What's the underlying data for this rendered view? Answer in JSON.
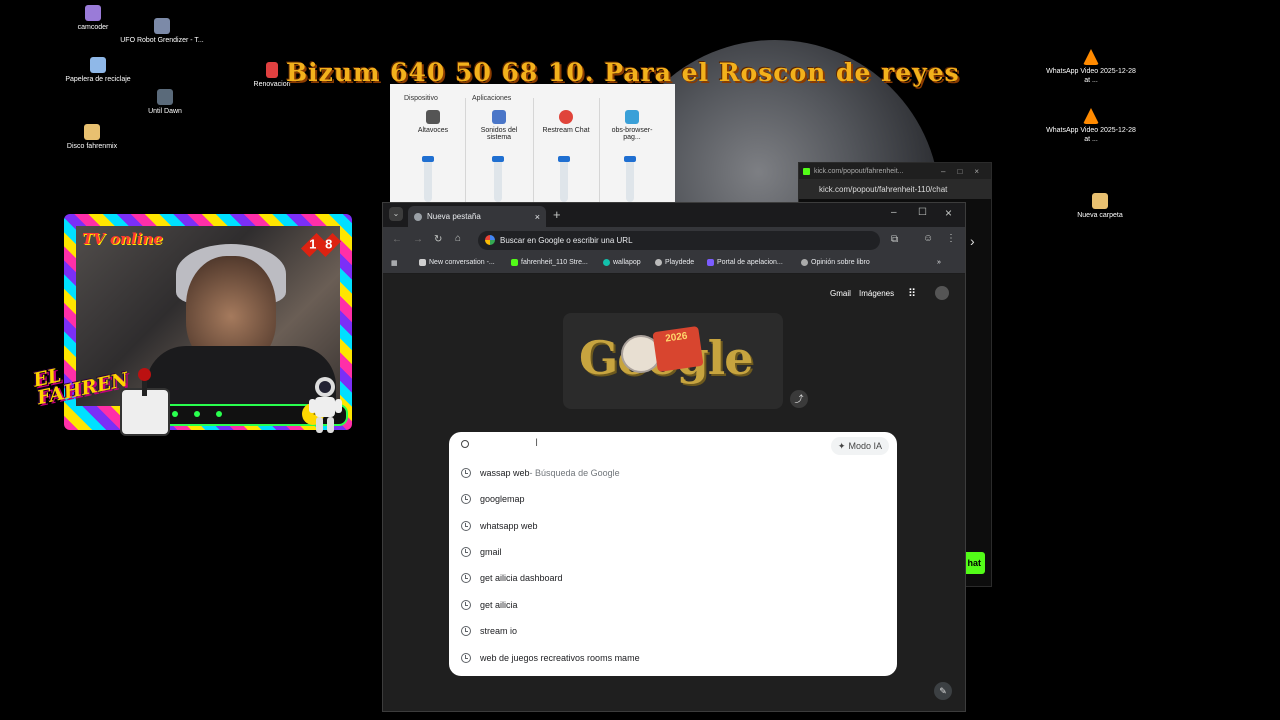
{
  "desktop": {
    "icons_left": [
      {
        "label": "camcoder",
        "color": "#9a7bd8"
      },
      {
        "label": "UFO Robot Grendizer - T...",
        "color": "#7c8aa8"
      },
      {
        "label": "Papelera de reciclaje",
        "color": "#8fb8e8"
      },
      {
        "label": "Until Dawn",
        "color": "#5a6a7a"
      },
      {
        "label": "Disco fahrenmix",
        "color": "#e8c070"
      },
      {
        "label": "Renovacion",
        "color": "#e04040"
      }
    ],
    "icons_right": [
      {
        "label": "WhatsApp Video 2025-12-28 at ...",
        "color": "#ff8a00"
      },
      {
        "label": "WhatsApp Video 2025-12-28 at ...",
        "color": "#ff8a00"
      },
      {
        "label": "Nueva carpeta",
        "color": "#e8c070"
      }
    ]
  },
  "overlay": {
    "title": "Bizum 640 50 68 10. Para el Roscon de reyes"
  },
  "mixer": {
    "section_device": "Dispositivo",
    "section_apps": "Aplicaciones",
    "channels": [
      {
        "label": "Altavoces",
        "color": "#555555"
      },
      {
        "label": "Sonidos del sistema",
        "color": "#4a76c8"
      },
      {
        "label": "Restream Chat",
        "color": "#e0443a"
      },
      {
        "label": "obs-browser-pag...",
        "color": "#3aa0d8"
      }
    ]
  },
  "kick": {
    "title": "kick.com/popout/fahrenheit...",
    "url": "kick.com/popout/fahrenheit-110/chat",
    "chat_label": "hat"
  },
  "cam": {
    "tv_label": "TV online",
    "num1": "1",
    "num2": "8",
    "logo_line1": "EL",
    "logo_line2": "FAHREN"
  },
  "chrome": {
    "tab_title": "Nueva pestaña",
    "omnibox_placeholder": "Buscar en Google o escribir una URL",
    "bookmarks": [
      {
        "label": "New conversation -...",
        "color": "#cfcfcf"
      },
      {
        "label": "fahrenheit_110 Stre...",
        "color": "#53fc18"
      },
      {
        "label": "wallapop",
        "color": "#13c1ac"
      },
      {
        "label": "Playdede",
        "color": "#bbbbbb"
      },
      {
        "label": "Portal de apelacion...",
        "color": "#7b5cff"
      },
      {
        "label": "Opinión sobre libro",
        "color": "#aaaaaa"
      }
    ],
    "gmail": "Gmail",
    "images": "Imágenes",
    "doodle_year": "2026",
    "doodle_text": "Google",
    "modo_ia": "Modo IA",
    "suggestions": [
      {
        "text": "wassap web",
        "sub": " - Búsqueda de Google"
      },
      {
        "text": "googlemap",
        "sub": ""
      },
      {
        "text": "whatsapp web",
        "sub": ""
      },
      {
        "text": "gmail",
        "sub": ""
      },
      {
        "text": "get ailicia dashboard",
        "sub": ""
      },
      {
        "text": "get ailicia",
        "sub": ""
      },
      {
        "text": "stream io",
        "sub": ""
      },
      {
        "text": "web de juegos recreativos rooms mame",
        "sub": ""
      }
    ]
  }
}
